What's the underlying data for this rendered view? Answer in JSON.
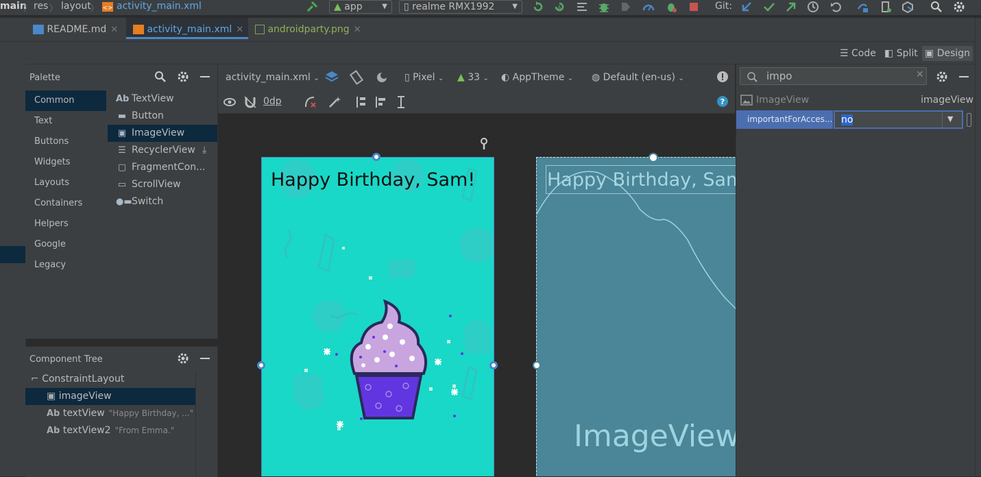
{
  "navbar": {
    "crumbs": [
      "main",
      "res",
      "layout",
      "activity_main.xml"
    ],
    "run_config": "app",
    "device": "realme RMX1992",
    "git_label": "Git:"
  },
  "tabs": [
    {
      "label": "README.md",
      "active": false
    },
    {
      "label": "activity_main.xml",
      "active": true
    },
    {
      "label": "androidparty.png",
      "active": false
    }
  ],
  "view_modes": {
    "code": "Code",
    "split": "Split",
    "design": "Design",
    "active": "Design"
  },
  "palette": {
    "title": "Palette",
    "categories": [
      "Common",
      "Text",
      "Buttons",
      "Widgets",
      "Layouts",
      "Containers",
      "Helpers",
      "Google",
      "Legacy"
    ],
    "selected_category": "Common",
    "widgets": [
      {
        "icon": "Ab",
        "label": "TextView"
      },
      {
        "icon": "button-icon",
        "label": "Button"
      },
      {
        "icon": "image-icon",
        "label": "ImageView"
      },
      {
        "icon": "list-icon",
        "label": "RecyclerView"
      },
      {
        "icon": "fragment-icon",
        "label": "FragmentCon..."
      },
      {
        "icon": "scroll-icon",
        "label": "ScrollView"
      },
      {
        "icon": "switch-icon",
        "label": "Switch"
      }
    ],
    "selected_widget": "ImageView"
  },
  "component_tree": {
    "title": "Component Tree",
    "nodes": [
      {
        "icon": "constraint-icon",
        "label": "ConstraintLayout",
        "detail": ""
      },
      {
        "icon": "image-icon",
        "label": "imageView",
        "detail": ""
      },
      {
        "icon": "Ab",
        "label": "textView",
        "detail": "\"Happy Birthday, ...\""
      },
      {
        "icon": "Ab",
        "label": "textView2",
        "detail": "\"From Emma.\""
      }
    ],
    "selected": "imageView"
  },
  "design_toolbar": {
    "file": "activity_main.xml",
    "device": "Pixel",
    "api": "33",
    "theme": "AppTheme",
    "locale": "Default (en-us)",
    "margin": "0dp"
  },
  "canvas": {
    "design_text": "Happy Birthday, Sam!",
    "blueprint_text": "Happy Birthday, Sam!",
    "blueprint_label": "ImageView",
    "colors": {
      "background": "#19d8c8",
      "frosting": "#c9a5e0",
      "cup": "#6136e0",
      "blueprint": "#4a8598"
    }
  },
  "attributes": {
    "search_value": "impo",
    "component_type": "ImageView",
    "component_id": "imageView",
    "attr_name": "importantForAcces...",
    "attr_value": "no"
  }
}
